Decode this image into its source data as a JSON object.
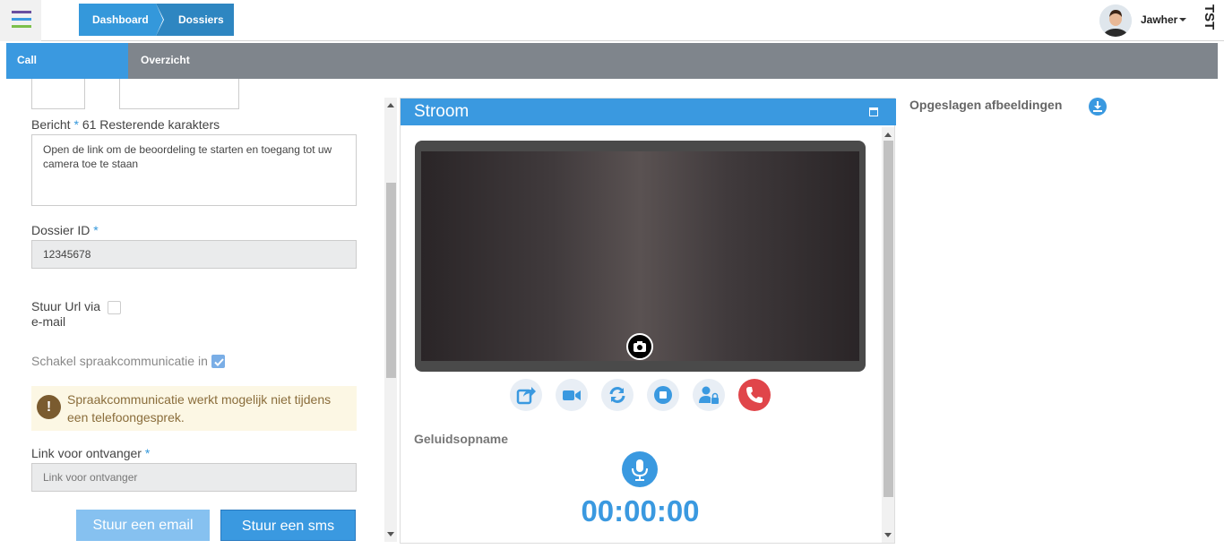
{
  "header": {
    "breadcrumbs": [
      "Dashboard",
      "Dossiers"
    ],
    "username": "Jawher",
    "app_badge": "TST"
  },
  "tabs": [
    "Call",
    "Overzicht"
  ],
  "form": {
    "message_label": "Bericht",
    "message_required": "*",
    "message_remaining": "61 Resterende karakters",
    "message_value": "Open de link om de beoordeling te starten en toegang tot uw camera toe te staan",
    "dossier_label": "Dossier ID",
    "dossier_required": "*",
    "dossier_value": "12345678",
    "send_url_label_1": "Stuur Url via",
    "send_url_label_2": "e-mail",
    "send_url_checked": false,
    "voice_label": "Schakel spraakcommunicatie in",
    "voice_checked": true,
    "warning_text": "Spraakcommunicatie werkt mogelijk niet tijdens een telefoongesprek.",
    "link_label": "Link voor ontvanger",
    "link_required": "*",
    "link_placeholder": "Link voor ontvanger",
    "btn_email": "Stuur een email",
    "btn_sms": "Stuur een sms"
  },
  "stream": {
    "title": "Stroom",
    "audio_title": "Geluidsopname",
    "timer": "00:00:00",
    "controls": [
      "share-icon",
      "video-camera-icon",
      "refresh-icon",
      "stop-icon",
      "user-lock-icon",
      "phone-hangup-icon"
    ]
  },
  "saved_images": {
    "title": "Opgeslagen afbeeldingen"
  },
  "colors": {
    "primary": "#3a99e0",
    "tabbar": "#7f858c",
    "danger": "#e0454a",
    "warning_bg": "#fcf7e4",
    "warning_text": "#8a6d3b"
  }
}
